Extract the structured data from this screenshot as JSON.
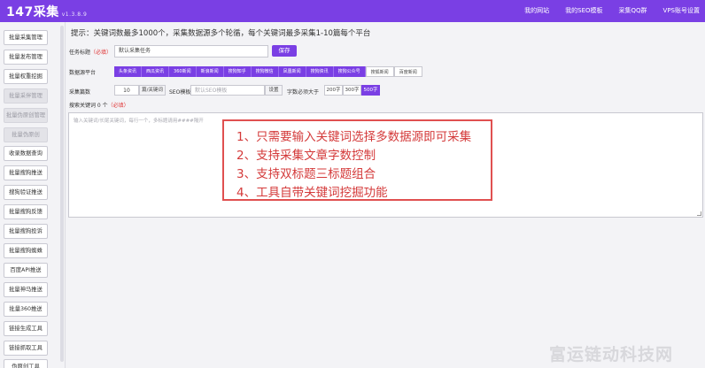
{
  "app": {
    "title": "147采集",
    "version": "v1.3.8.9"
  },
  "topnav": [
    "我的网站",
    "我的SEO模板",
    "采集QQ群",
    "VPS账号设置"
  ],
  "sidebar": {
    "items": [
      {
        "label": "批量采集管理",
        "disabled": false
      },
      {
        "label": "批量发布管理",
        "disabled": false
      },
      {
        "label": "批量权重挖掘",
        "disabled": false
      },
      {
        "label": "批量采伴管理",
        "disabled": true
      },
      {
        "label": "批量伪原创管理",
        "disabled": true
      },
      {
        "label": "批量伪原创",
        "disabled": true
      },
      {
        "label": "收录数据查询",
        "disabled": false
      },
      {
        "label": "批量搜狗推送",
        "disabled": false
      },
      {
        "label": "搜狗验证推送",
        "disabled": false
      },
      {
        "label": "批量搜狗反馈",
        "disabled": false
      },
      {
        "label": "批量搜狗投诉",
        "disabled": false
      },
      {
        "label": "批量搜狗蜘蛛",
        "disabled": false
      },
      {
        "label": "百度API推送",
        "disabled": false
      },
      {
        "label": "批量神马推送",
        "disabled": false
      },
      {
        "label": "批量360推送",
        "disabled": false
      },
      {
        "label": "链接生成工具",
        "disabled": false
      },
      {
        "label": "链接抓取工具",
        "disabled": false
      },
      {
        "label": "伪原创工具",
        "disabled": false
      }
    ]
  },
  "main": {
    "tip": "提示：关键词数最多1000个，采集数据源多个轮循，每个关键词最多采集1-10篇每个平台",
    "task_name": {
      "label": "任务标题",
      "required": "（必填）",
      "value": "默认采集任务"
    },
    "save_label": "保存",
    "sources": {
      "label": "数据源平台",
      "items": [
        {
          "label": "头条资讯",
          "active": true
        },
        {
          "label": "西瓜资讯",
          "active": true
        },
        {
          "label": "360新闻",
          "active": true
        },
        {
          "label": "新浪新闻",
          "active": true
        },
        {
          "label": "搜狗知乎",
          "active": true
        },
        {
          "label": "搜狗微信",
          "active": true
        },
        {
          "label": "凤凰新闻",
          "active": true
        },
        {
          "label": "搜狗资讯",
          "active": true
        },
        {
          "label": "搜狗公众号",
          "active": true
        },
        {
          "label": "搜狐新闻",
          "active": false
        },
        {
          "label": "百度新闻",
          "active": false
        }
      ]
    },
    "collect_count": {
      "label": "采集篇数",
      "value": "10",
      "unit": "篇/关键词"
    },
    "seo_template": {
      "label": "SEO模板",
      "placeholder": "默认SEO模板",
      "button": "设置"
    },
    "word_count": {
      "label": "字数必须大于",
      "options": [
        {
          "label": "200字",
          "active": false
        },
        {
          "label": "300字",
          "active": false
        },
        {
          "label": "500字",
          "active": true
        }
      ]
    },
    "keywords": {
      "label": "搜索关键词 0 个",
      "required": "（必填）",
      "placeholder": "输入关键词/长尾关键词，每行一个，多标题请用####隔开"
    },
    "overlay_lines": [
      "1、只需要输入关键词选择多数据源即可采集",
      "2、支持采集文章字数控制",
      "3、支持双标题三标题组合",
      "4、工具自带关键词挖掘功能"
    ],
    "watermark": "富运链动科技网"
  },
  "colors": {
    "accent": "#7a3fe4",
    "danger": "#e03636"
  }
}
